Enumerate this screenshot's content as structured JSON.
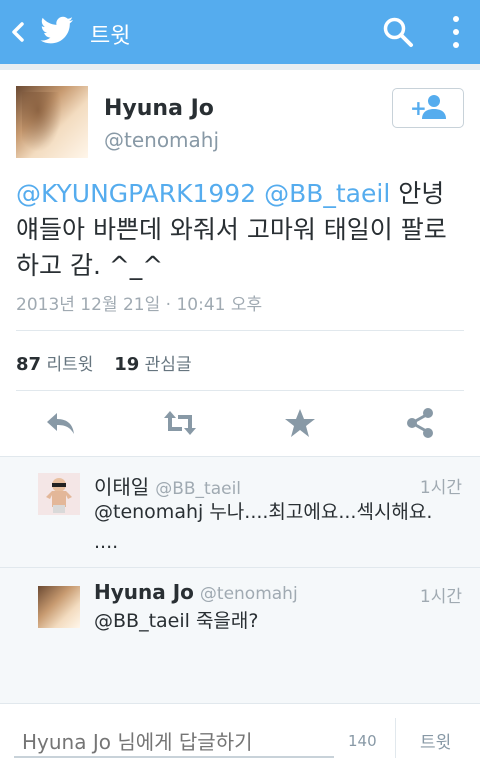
{
  "topbar": {
    "title": "트윗",
    "bg_color": "#55acee"
  },
  "tweet": {
    "name": "Hyuna Jo",
    "handle": "@tenomahj",
    "mention1": "@KYUNGPARK1992",
    "mention2": "@BB_taeil",
    "text_after": " 안녕 얘들아 바쁜데 와줘서 고마워 태일이 팔로하고 감. ^_^",
    "date": "2013년 12월 21일 · 10:41 오후",
    "retweets_count": "87",
    "retweets_label": "리트윗",
    "favorites_count": "19",
    "favorites_label": "관심글"
  },
  "replies": [
    {
      "name": "이태일",
      "handle": "@BB_taeil",
      "time": "1시간",
      "text": "@tenomahj 누나....최고에요...섹시해요.\n....",
      "icon": "avatar-kid"
    },
    {
      "name": "Hyuna Jo",
      "handle": "@tenomahj",
      "time": "1시간",
      "text": "@BB_taeil 죽을래?",
      "icon": "avatar-hyuna"
    }
  ],
  "composer": {
    "placeholder": "Hyuna Jo 님에게 답글하기",
    "count": "140",
    "send_label": "트윗"
  },
  "colors": {
    "accent": "#55acee",
    "icon_gray": "#8899a6"
  }
}
